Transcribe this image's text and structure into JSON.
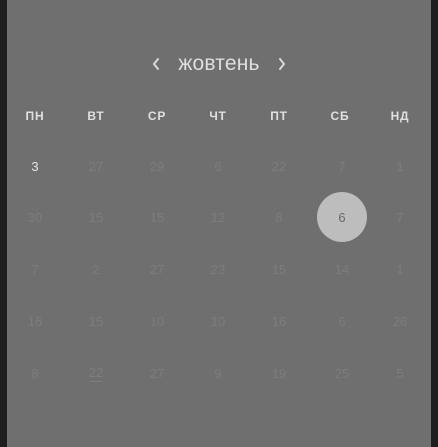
{
  "calendar": {
    "month_label": "жовтень",
    "prev_icon": "chevron-left-icon",
    "next_icon": "chevron-right-icon",
    "weekdays": [
      "ПН",
      "ВТ",
      "СР",
      "ЧТ",
      "ПТ",
      "СБ",
      "НД"
    ],
    "weeks": [
      [
        {
          "label": "3",
          "state": "current"
        },
        {
          "label": "27",
          "state": "muted"
        },
        {
          "label": "29",
          "state": "muted"
        },
        {
          "label": "6",
          "state": "muted"
        },
        {
          "label": "22",
          "state": "muted"
        },
        {
          "label": "7",
          "state": "muted"
        },
        {
          "label": "1",
          "state": "muted"
        }
      ],
      [
        {
          "label": "30",
          "state": "muted"
        },
        {
          "label": "15",
          "state": "muted"
        },
        {
          "label": "15",
          "state": "muted"
        },
        {
          "label": "12",
          "state": "muted"
        },
        {
          "label": "8",
          "state": "muted"
        },
        {
          "label": "6",
          "state": "selected"
        },
        {
          "label": "7",
          "state": "muted"
        }
      ],
      [
        {
          "label": "7",
          "state": "muted"
        },
        {
          "label": "2",
          "state": "muted"
        },
        {
          "label": "27",
          "state": "muted"
        },
        {
          "label": "23",
          "state": "muted"
        },
        {
          "label": "15",
          "state": "muted"
        },
        {
          "label": "14",
          "state": "muted"
        },
        {
          "label": "1",
          "state": "muted"
        }
      ],
      [
        {
          "label": "16",
          "state": "muted"
        },
        {
          "label": "15",
          "state": "muted"
        },
        {
          "label": "10",
          "state": "muted"
        },
        {
          "label": "10",
          "state": "muted"
        },
        {
          "label": "16",
          "state": "muted"
        },
        {
          "label": "6",
          "state": "muted"
        },
        {
          "label": "26",
          "state": "muted"
        }
      ],
      [
        {
          "label": "8",
          "state": "muted"
        },
        {
          "label": "22",
          "state": "muted",
          "underlined": true
        },
        {
          "label": "27",
          "state": "muted"
        },
        {
          "label": "9",
          "state": "muted"
        },
        {
          "label": "19",
          "state": "muted"
        },
        {
          "label": "25",
          "state": "muted"
        },
        {
          "label": "5",
          "state": "muted"
        }
      ]
    ]
  },
  "colors": {
    "panel_bg": "#6f6f6f",
    "outer_bg": "#1e1e1e",
    "text_primary": "#e3e3e3",
    "text_muted": "#7d7d7d",
    "selected_bg": "#bdbdbd"
  }
}
